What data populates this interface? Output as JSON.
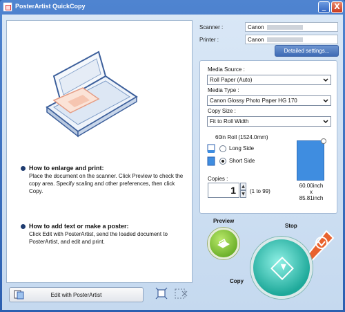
{
  "window": {
    "title": "PosterArtist QuickCopy",
    "minimize": "_",
    "close": "X"
  },
  "info": {
    "scanner_label": "Scanner :",
    "scanner_value": "Canon",
    "printer_label": "Printer :",
    "printer_value": "Canon",
    "detailed_button": "Detailed settings..."
  },
  "settings": {
    "media_source_label": "Media Source :",
    "media_source_value": "Roll Paper (Auto)",
    "media_type_label": "Media Type :",
    "media_type_value": "Canon Glossy Photo Paper HG 170",
    "copy_size_label": "Copy Size :",
    "copy_size_value": "Fit to Roll Width",
    "roll_text": "60in Roll (1524.0mm)",
    "long_side": "Long Side",
    "short_side": "Short Side",
    "selected_orientation": "Short Side",
    "copies_label": "Copies :",
    "copies_value": "1",
    "copies_range": "(1 to 99)",
    "width": "60.00inch",
    "times": "x",
    "height": "85.81inch"
  },
  "help": {
    "enlarge_title": "How to enlarge and print:",
    "enlarge_body": "Place the document on the scanner. Click Preview to check the copy area. Specify scaling and other preferences, then click Copy.",
    "poster_title": "How to add text or make a poster:",
    "poster_body": "Click Edit with PosterArtist, send the loaded document to PosterArtist, and edit and print."
  },
  "actions": {
    "edit_button": "Edit with PosterArtist",
    "preview_label": "Preview",
    "copy_label": "Copy",
    "stop_label": "Stop"
  },
  "colors": {
    "titlebar": "#2b5fb0",
    "preview_green": "#4f9b12",
    "copy_teal": "#1ea99a",
    "stop_orange": "#e8622e",
    "paper_blue": "#3f8de0"
  }
}
